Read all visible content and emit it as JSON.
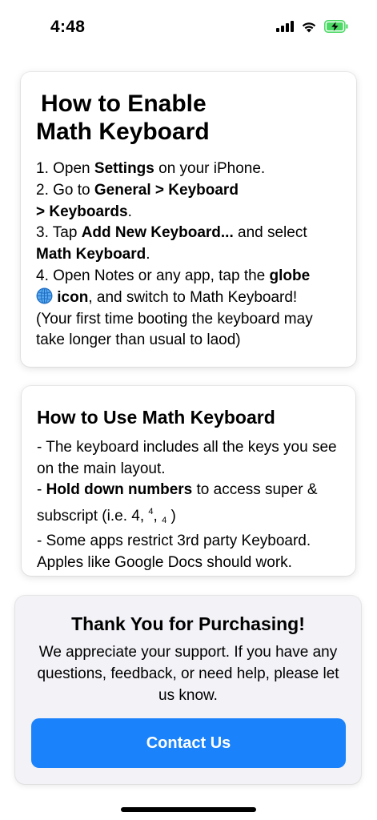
{
  "status_bar": {
    "time": "4:48",
    "icons": [
      "signal-icon",
      "wifi-icon",
      "battery-charging-icon"
    ],
    "battery_color": "#4cd964"
  },
  "enable_card": {
    "title_line1": "How to Enable",
    "title_line2": "Math Keyboard",
    "step1": {
      "prefix": "1. Open ",
      "bold": "Settings",
      "suffix": " on your iPhone."
    },
    "step2": {
      "prefix": "2. Go to ",
      "bold": "General > Keyboard",
      "bold2": "> Keyboards",
      "suffix": "."
    },
    "step3": {
      "prefix": "3. Tap ",
      "bold": "Add New Keyboard...",
      "middle": " and select ",
      "bold2": "Math Keyboard",
      "suffix": "."
    },
    "step4": {
      "prefix": "4. Open Notes or any app, tap the ",
      "bold": "globe",
      "bold2": "icon",
      "suffix": ", and switch to Math Keyboard!"
    },
    "note": "(Your first time booting the keyboard may take longer than usual to laod)"
  },
  "use_card": {
    "title": "How to Use Math Keyboard",
    "item1": "- The keyboard includes all the keys you see on the main layout.",
    "item2": {
      "prefix": "- ",
      "bold": "Hold down numbers",
      "suffix": " to access super & subscript (i.e. 4, ",
      "sup": "4",
      "comma": ", ",
      "sub": "4",
      "close": " )"
    },
    "item3": "- Some apps restrict 3rd party Keyboard. Apples like Google Docs should work."
  },
  "thanks_card": {
    "title": "Thank You for Purchasing!",
    "body": "We appreciate your support. If you have any questions, feedback, or need help, please let us know.",
    "button_label": "Contact Us",
    "button_color": "#1a82fb"
  }
}
